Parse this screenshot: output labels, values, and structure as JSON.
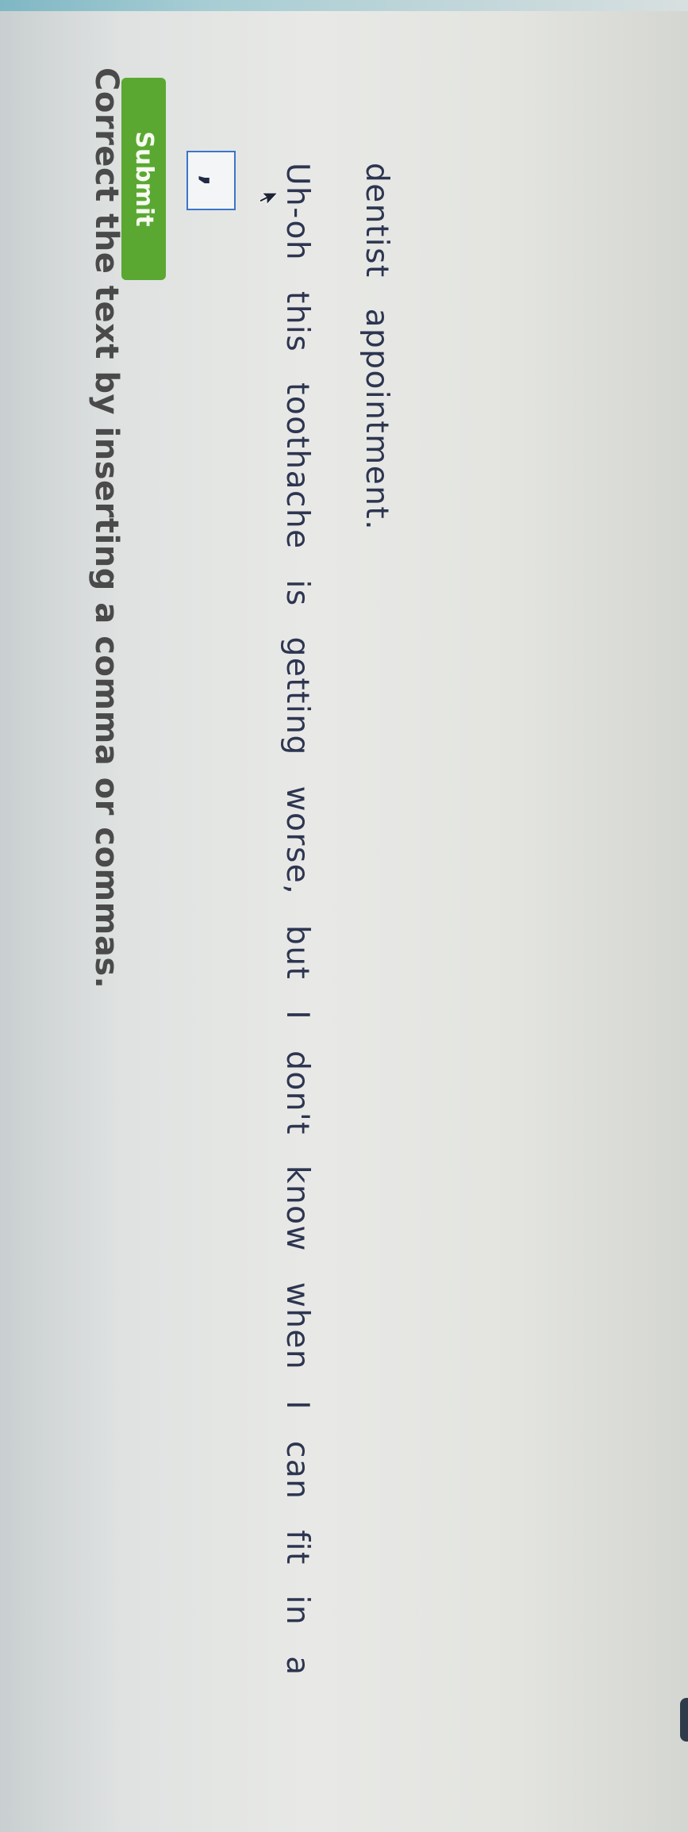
{
  "exercise": {
    "instruction": "Correct the text by inserting a comma or commas.",
    "comma_tile": ",",
    "sentence_line1": "Uh-oh this toothache is getting worse, but I don't know when I can fit in a",
    "sentence_line2": "dentist appointment."
  },
  "actions": {
    "submit_label": "Submit"
  },
  "colors": {
    "submit": "#5aa832",
    "tile_border": "#3d74c9",
    "text": "#2d3550"
  },
  "icons": [
    "cursor-arrow-icon"
  ]
}
